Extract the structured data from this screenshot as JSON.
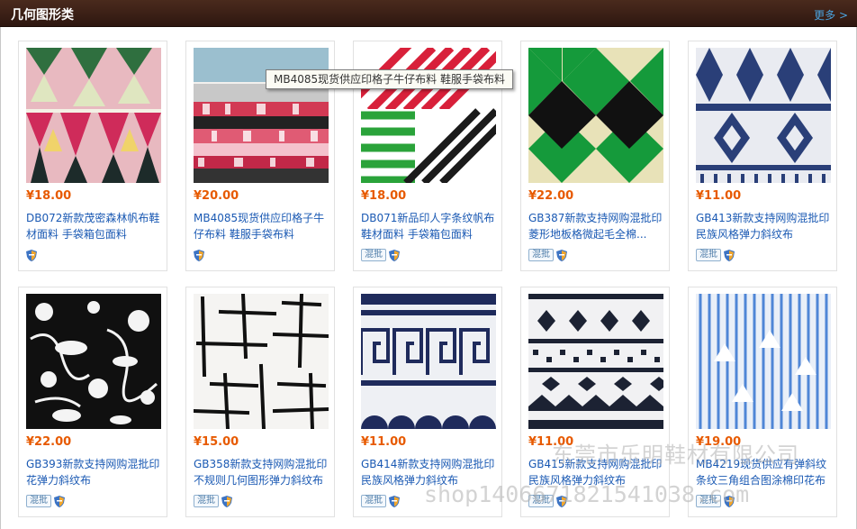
{
  "section": {
    "title": "几何图形类",
    "more_label": "更多 >"
  },
  "products": [
    {
      "price": "¥18.00",
      "title": "DB072新款茂密森林帆布鞋材面料 手袋箱包面料",
      "mixed_batch": false,
      "mixed_label": ""
    },
    {
      "price": "¥20.00",
      "title": "MB4085现货供应印格子牛仔布料 鞋服手袋布料",
      "mixed_batch": false,
      "mixed_label": ""
    },
    {
      "price": "¥18.00",
      "title": "DB071新品印人字条纹帆布鞋材面料 手袋箱包面料",
      "mixed_batch": true,
      "mixed_label": "混批"
    },
    {
      "price": "¥22.00",
      "title": "GB387新款支持网购混批印菱形地板格微起毛全棉...",
      "mixed_batch": true,
      "mixed_label": "混批"
    },
    {
      "price": "¥11.00",
      "title": "GB413新款支持网购混批印民族风格弹力斜纹布",
      "mixed_batch": true,
      "mixed_label": "混批"
    },
    {
      "price": "¥22.00",
      "title": "GB393新款支持网购混批印花弹力斜纹布",
      "mixed_batch": true,
      "mixed_label": "混批"
    },
    {
      "price": "¥15.00",
      "title": "GB358新款支持网购混批印不规则几何图形弹力斜纹布",
      "mixed_batch": true,
      "mixed_label": "混批"
    },
    {
      "price": "¥11.00",
      "title": "GB414新款支持网购混批印民族风格弹力斜纹布",
      "mixed_batch": true,
      "mixed_label": "混批"
    },
    {
      "price": "¥11.00",
      "title": "GB415新款支持网购混批印民族风格弹力斜纹布",
      "mixed_batch": true,
      "mixed_label": "混批"
    },
    {
      "price": "¥19.00",
      "title": "MB4219现货供应有弹斜纹条纹三角组合图涂棉印花布",
      "mixed_batch": true,
      "mixed_label": "混批"
    }
  ],
  "tooltip": {
    "text": "MB4085现货供应印格子牛仔布料 鞋服手袋布料"
  },
  "watermark": {
    "line1": "东莞市乐明鞋材有限公司",
    "line2": "shop1406671821541038.com"
  },
  "colors": {
    "header_bg": "#3a1f15",
    "price": "#e75a00",
    "link": "#1a59b3"
  },
  "icons": {
    "trust": "shield-icon"
  }
}
